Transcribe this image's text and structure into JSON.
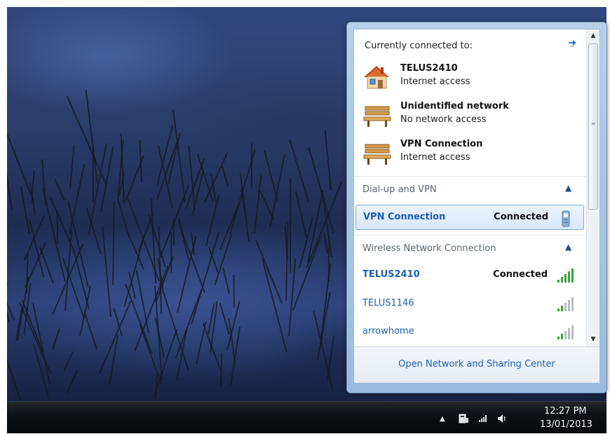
{
  "flyout": {
    "current_label": "Currently connected to:",
    "current_connections": [
      {
        "name": "TELUS2410",
        "status": "Internet access",
        "icon": "home-network-icon"
      },
      {
        "name": "Unidentified network",
        "status": "No network access",
        "icon": "public-network-bench-icon"
      },
      {
        "name": "VPN Connection",
        "status": "Internet access",
        "icon": "public-network-bench-icon"
      }
    ],
    "groups": [
      {
        "title": "Dial-up and VPN",
        "items": [
          {
            "name": "VPN Connection",
            "state": "Connected",
            "icon": "vpn-phone-icon",
            "selected": true
          }
        ]
      },
      {
        "title": "Wireless Network Connection",
        "items": [
          {
            "name": "TELUS2410",
            "state": "Connected",
            "icon": "wifi-signal-icon",
            "signal_bars": 5
          },
          {
            "name": "TELUS1146",
            "state": "",
            "icon": "wifi-signal-icon",
            "signal_bars": 2
          },
          {
            "name": "arrowhome",
            "state": "",
            "icon": "wifi-signal-icon",
            "signal_bars": 2
          }
        ]
      }
    ],
    "footer_link": "Open Network and Sharing Center"
  },
  "taskbar": {
    "clock_time": "12:27 PM",
    "clock_date": "13/01/2013",
    "tray_icons": [
      "show-hidden-icons-arrow",
      "action-center-icon",
      "network-signal-icon",
      "volume-icon"
    ]
  },
  "colors": {
    "link_blue": "#1b5fb2",
    "signal_green": "#3aa33a",
    "signal_gray": "#b8bcc2"
  }
}
